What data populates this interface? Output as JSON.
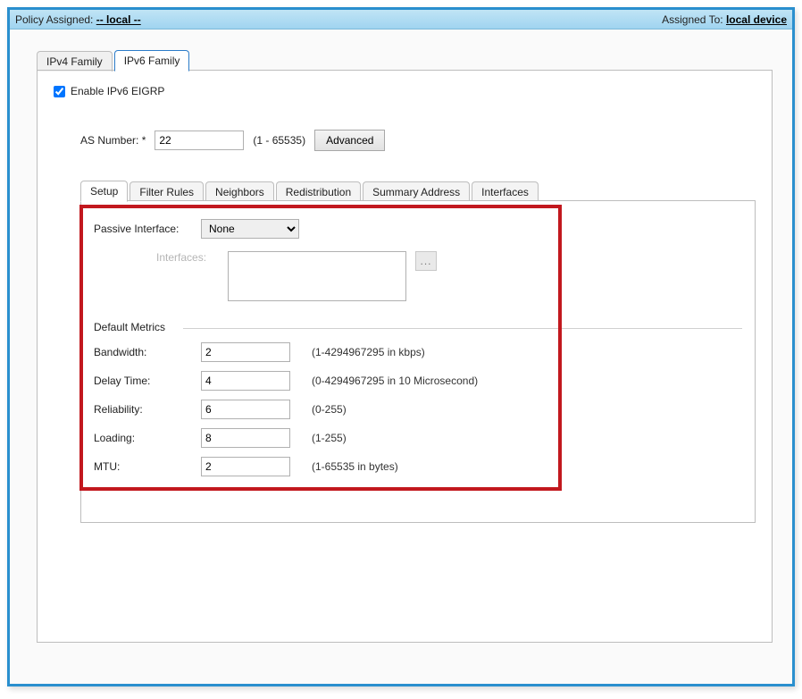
{
  "header": {
    "policy_label": "Policy Assigned:",
    "policy_value": "-- local --",
    "assigned_to_label": "Assigned To:",
    "assigned_to_value": "local device"
  },
  "top_tabs": {
    "ipv4": "IPv4 Family",
    "ipv6": "IPv6 Family",
    "active": "ipv6"
  },
  "enable_checkbox": {
    "label": "Enable IPv6 EIGRP",
    "checked": true
  },
  "as_number": {
    "label": "AS Number: *",
    "value": "22",
    "range": "(1 - 65535)",
    "advanced_btn": "Advanced"
  },
  "inner_tabs": {
    "items": [
      "Setup",
      "Filter Rules",
      "Neighbors",
      "Redistribution",
      "Summary Address",
      "Interfaces"
    ],
    "active": 0
  },
  "setup": {
    "passive_interface_label": "Passive Interface:",
    "passive_interface_value": "None",
    "interfaces_label": "Interfaces:",
    "ellipsis": "...",
    "default_metrics_label": "Default Metrics",
    "metrics": [
      {
        "label": "Bandwidth:",
        "value": "2",
        "hint": "(1-4294967295 in kbps)"
      },
      {
        "label": "Delay Time:",
        "value": "4",
        "hint": "(0-4294967295 in 10 Microsecond)"
      },
      {
        "label": "Reliability:",
        "value": "6",
        "hint": "(0-255)"
      },
      {
        "label": "Loading:",
        "value": "8",
        "hint": "(1-255)"
      },
      {
        "label": "MTU:",
        "value": "2",
        "hint": "(1-65535 in bytes)"
      }
    ]
  }
}
